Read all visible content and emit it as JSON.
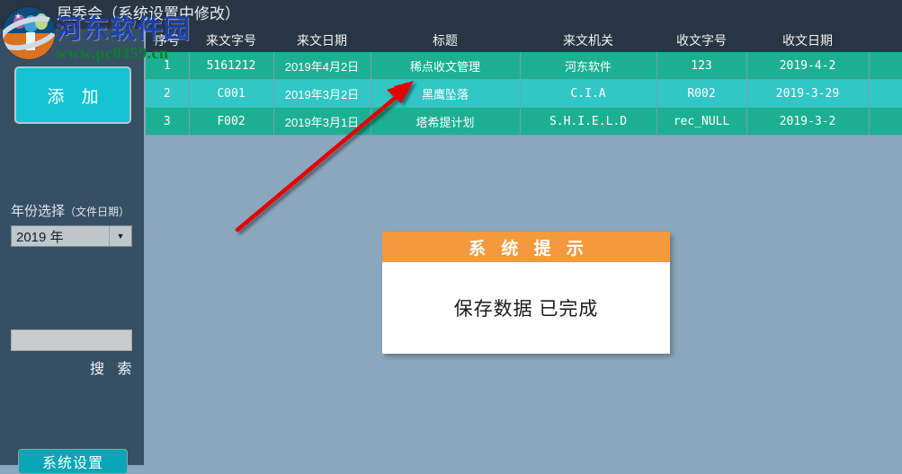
{
  "window": {
    "title": "居委会（系统设置中修改）",
    "logo_icon": "app-globe-people-icon"
  },
  "watermark": {
    "line1": "河东软件园",
    "line2": "www.pc0359.cn"
  },
  "sidebar": {
    "add_button": "添  加",
    "year_label_main": "年份选择",
    "year_label_sub": "（文件日期）",
    "year_value": "2019  年",
    "year_arrow_icon": "chevron-down-icon",
    "search_value": "",
    "search_placeholder": "",
    "search_label": "搜 索",
    "system_settings_button": "系统设置"
  },
  "table": {
    "columns": [
      "序号",
      "来文字号",
      "来文日期",
      "标题",
      "来文机关",
      "收文字号",
      "收文日期",
      ""
    ],
    "rows": [
      [
        "1",
        "5161212",
        "2019年4月2日",
        "稀点收文管理",
        "河东软件",
        "123",
        "2019-4-2",
        ""
      ],
      [
        "2",
        "C001",
        "2019年3月2日",
        "黑鹰坠落",
        "C.I.A",
        "R002",
        "2019-3-29",
        ""
      ],
      [
        "3",
        "F002",
        "2019年3月1日",
        "塔希提计划",
        "S.H.I.E.L.D",
        "rec_NULL",
        "2019-3-2",
        ""
      ]
    ]
  },
  "dialog": {
    "header": "系 统 提 示",
    "message": "保存数据 已完成"
  },
  "annotation": {
    "arrow_icon": "red-arrow-icon"
  },
  "colors": {
    "titlebar": "#273642",
    "sidebar": "#374f63",
    "background": "#8aa7bd",
    "row_odd": "#1cb092",
    "row_even": "#30c7c6",
    "accent_cyan": "#14c3d4",
    "dialog_header": "#f59a3c",
    "arrow_red": "#e60000"
  }
}
